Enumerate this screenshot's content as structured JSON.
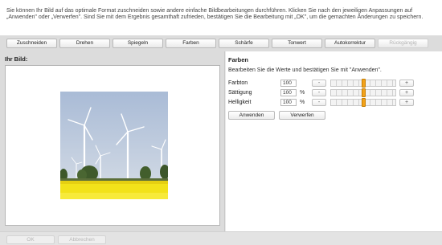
{
  "intro": {
    "text": "Sie können Ihr Bild auf das optimale Format zuschneiden sowie andere einfache Bildbearbeitungen durchführen. Klicken Sie nach den jeweiligen Anpassungen auf „Anwenden\" oder „Verwerfen\". Sind Sie mit dem Ergebnis gesamthaft zufrieden, bestätigen Sie die Bearbeitung mit „OK\", um die gemachten Änderungen zu speichern."
  },
  "toolbar": {
    "buttons": [
      {
        "label": "Zuschneiden",
        "enabled": true
      },
      {
        "label": "Drehen",
        "enabled": true
      },
      {
        "label": "Spiegeln",
        "enabled": true
      },
      {
        "label": "Farben",
        "enabled": true
      },
      {
        "label": "Schärfe",
        "enabled": true
      },
      {
        "label": "Tonwert",
        "enabled": true
      },
      {
        "label": "Autokorrektur",
        "enabled": true
      },
      {
        "label": "Rückgängig",
        "enabled": false
      }
    ]
  },
  "image_panel": {
    "title": "Ihr Bild:"
  },
  "colors_panel": {
    "title": "Farben",
    "instruction": "Bearbeiten Sie die Werte und bestätigen Sie mit \"Anwenden\".",
    "rows": [
      {
        "label": "Farbton",
        "value": "100",
        "unit": "",
        "minus": "-",
        "plus": "+",
        "level": 0.5
      },
      {
        "label": "Sättigung",
        "value": "100",
        "unit": "%",
        "minus": "-",
        "plus": "+",
        "level": 0.5
      },
      {
        "label": "Helligkeit",
        "value": "100",
        "unit": "%",
        "minus": "-",
        "plus": "+",
        "level": 0.5
      }
    ],
    "apply_label": "Anwenden",
    "discard_label": "Verwerfen"
  },
  "bottom": {
    "ok_label": "OK",
    "cancel_label": "Abbrechen"
  },
  "colors": {
    "slider_thumb": "#f3a21a",
    "panel_bg": "#dcdcdc",
    "sky": "#b7c7dd",
    "field": "#f2e21a"
  }
}
